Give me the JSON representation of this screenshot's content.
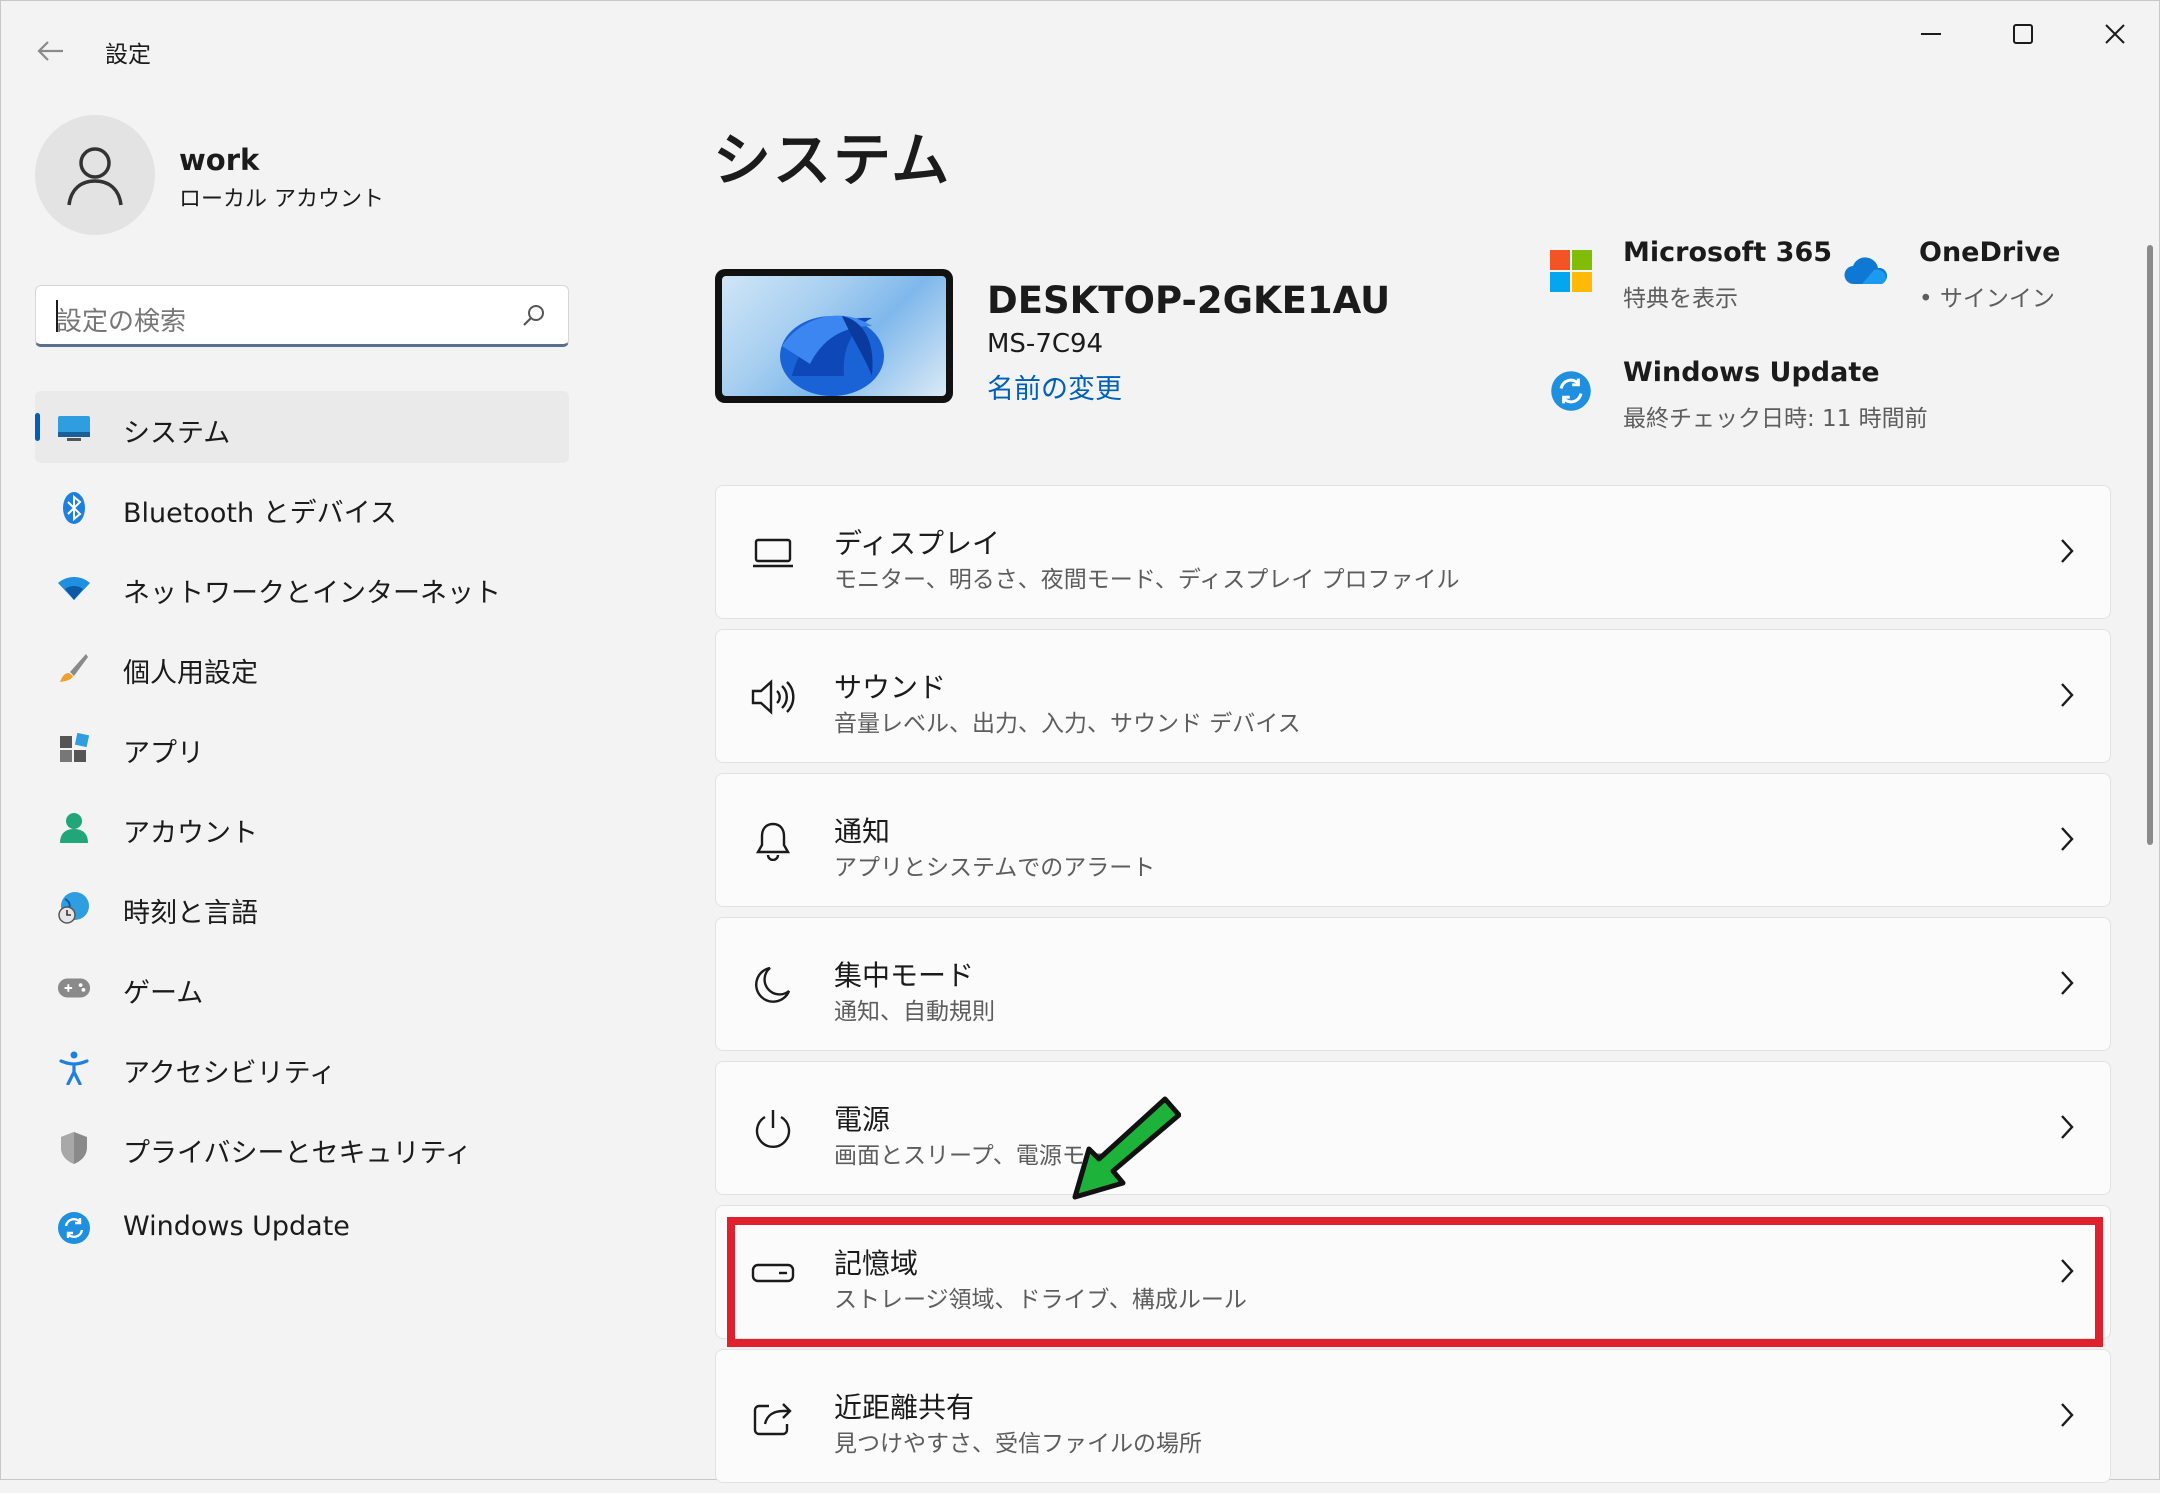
{
  "window": {
    "title": "設定",
    "controls": [
      "minimize",
      "maximize",
      "close"
    ]
  },
  "profile": {
    "name": "work",
    "account_type": "ローカル アカウント"
  },
  "search": {
    "placeholder": "設定の検索"
  },
  "sidebar": {
    "items": [
      {
        "label": "システム",
        "icon": "system-icon",
        "active": true
      },
      {
        "label": "Bluetooth とデバイス",
        "icon": "bluetooth-icon"
      },
      {
        "label": "ネットワークとインターネット",
        "icon": "wifi-icon"
      },
      {
        "label": "個人用設定",
        "icon": "paintbrush-icon"
      },
      {
        "label": "アプリ",
        "icon": "apps-icon"
      },
      {
        "label": "アカウント",
        "icon": "person-icon"
      },
      {
        "label": "時刻と言語",
        "icon": "globe-clock-icon"
      },
      {
        "label": "ゲーム",
        "icon": "gamepad-icon"
      },
      {
        "label": "アクセシビリティ",
        "icon": "accessibility-icon"
      },
      {
        "label": "プライバシーとセキュリティ",
        "icon": "shield-icon"
      },
      {
        "label": "Windows Update",
        "icon": "update-icon"
      }
    ]
  },
  "main": {
    "title": "システム",
    "device": {
      "name": "DESKTOP-2GKE1AU",
      "model": "MS-7C94",
      "rename_label": "名前の変更"
    },
    "quick": {
      "m365": {
        "title": "Microsoft 365",
        "sub": "特典を表示"
      },
      "onedrive": {
        "title": "OneDrive",
        "sub": "• サインイン"
      },
      "update": {
        "title": "Windows Update",
        "sub": "最終チェック日時: 11 時間前"
      }
    },
    "cards": [
      {
        "title": "ディスプレイ",
        "sub": "モニター、明るさ、夜間モード、ディスプレイ プロファイル",
        "icon": "display-icon"
      },
      {
        "title": "サウンド",
        "sub": "音量レベル、出力、入力、サウンド デバイス",
        "icon": "speaker-icon"
      },
      {
        "title": "通知",
        "sub": "アプリとシステムでのアラート",
        "icon": "bell-icon"
      },
      {
        "title": "集中モード",
        "sub": "通知、自動規則",
        "icon": "moon-icon"
      },
      {
        "title": "電源",
        "sub": "画面とスリープ、電源モード",
        "icon": "power-icon"
      },
      {
        "title": "記憶域",
        "sub": "ストレージ領域、ドライブ、構成ルール",
        "icon": "storage-icon"
      },
      {
        "title": "近距離共有",
        "sub": "見つけやすさ、受信ファイルの場所",
        "icon": "share-icon"
      }
    ]
  },
  "annotations": {
    "highlight_color": "#e0202c",
    "arrow_color": "#1db33a",
    "highlighted_card": "記憶域"
  },
  "colors": {
    "accent": "#005fb8",
    "background": "#f3f3f3",
    "card": "#fbfbfb"
  }
}
